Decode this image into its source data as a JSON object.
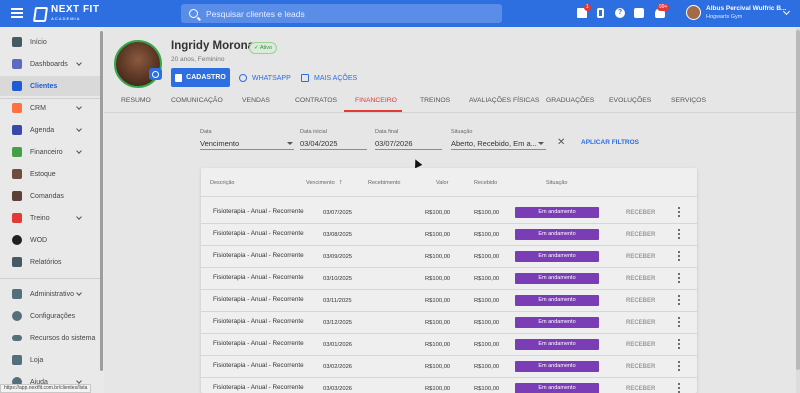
{
  "topbar": {
    "brand": "NEXT FIT",
    "brand_sub": "ACADEMIA",
    "search_placeholder": "Pesquisar clientes e leads",
    "gift_badge": "1",
    "notif_badge": "99+",
    "user_name": "Albus Percival Wulfric B...",
    "user_gym": "Hogwarts Gym",
    "help_glyph": "?"
  },
  "sidebar": {
    "items": [
      {
        "label": "Início",
        "icon": "home-icon",
        "color": "#455a64"
      },
      {
        "label": "Dashboards",
        "icon": "chart-icon",
        "color": "#5c6bc0"
      },
      {
        "label": "Clientes",
        "icon": "people-icon",
        "color": "#1e5bd4"
      },
      {
        "label": "CRM",
        "icon": "crm-icon",
        "color": "#ff7043"
      },
      {
        "label": "Agenda",
        "icon": "calendar-icon",
        "color": "#3949ab"
      },
      {
        "label": "Financeiro",
        "icon": "money-icon",
        "color": "#43a047"
      },
      {
        "label": "Estoque",
        "icon": "cart-icon",
        "color": "#6d4c41"
      },
      {
        "label": "Comandas",
        "icon": "receipt-icon",
        "color": "#5d4037"
      },
      {
        "label": "Treino",
        "icon": "dumbbell-icon",
        "color": "#e53935"
      },
      {
        "label": "WOD",
        "icon": "kettlebell-icon",
        "color": "#212121"
      },
      {
        "label": "Relatórios",
        "icon": "report-icon",
        "color": "#455a64"
      },
      {
        "label": "Administrativo",
        "icon": "admin-icon",
        "color": "#546e7a"
      },
      {
        "label": "Configurações",
        "icon": "gear-icon",
        "color": "#546e7a"
      },
      {
        "label": "Recursos do sistema",
        "icon": "toggle-icon",
        "color": "#546e7a"
      },
      {
        "label": "Loja",
        "icon": "store-icon",
        "color": "#546e7a"
      },
      {
        "label": "Ajuda",
        "icon": "help-icon",
        "color": "#546e7a"
      }
    ],
    "url_tooltip": "https://app.nextfit.com.br/clientes/lista"
  },
  "profile": {
    "name": "Ingridy Morona",
    "status": "Ativo",
    "info": "20 anos, Feminino",
    "cadastro_label": "CADASTRO",
    "whatsapp_label": "WHATSAPP",
    "mais_label": "MAIS AÇÕES"
  },
  "tabs": [
    "RESUMO",
    "COMUNICAÇÃO",
    "VENDAS",
    "CONTRATOS",
    "FINANCEIRO",
    "TREINOS",
    "AVALIAÇÕES FÍSICAS",
    "GRADUAÇÕES",
    "EVOLUÇÕES",
    "SERVIÇOS"
  ],
  "filters": {
    "data_label": "Data",
    "data_value": "Vencimento",
    "inicial_label": "Data inicial",
    "inicial_value": "03/04/2025",
    "final_label": "Data final",
    "final_value": "03/07/2026",
    "situacao_label": "Situação",
    "situacao_value": "Aberto, Recebido, Em a...",
    "clear_glyph": "✕",
    "apply_label": "APLICAR FILTROS"
  },
  "table": {
    "headers": {
      "descricao": "Descrição",
      "vencimento": "Vencimento",
      "recebimento": "Recebimento",
      "valor": "Valor",
      "recebido": "Recebido",
      "situacao": "Situação"
    },
    "sort_glyph": "↑",
    "action_label": "RECEBER",
    "rows": [
      {
        "desc": "Fisioterapia - Anual - Recorrente",
        "venc": "03/07/2025",
        "valor": "R$100,00",
        "recebido": "R$100,00",
        "status": "Em andamento"
      },
      {
        "desc": "Fisioterapia - Anual - Recorrente",
        "venc": "03/08/2025",
        "valor": "R$100,00",
        "recebido": "R$100,00",
        "status": "Em andamento"
      },
      {
        "desc": "Fisioterapia - Anual - Recorrente",
        "venc": "03/09/2025",
        "valor": "R$100,00",
        "recebido": "R$100,00",
        "status": "Em andamento"
      },
      {
        "desc": "Fisioterapia - Anual - Recorrente",
        "venc": "03/10/2025",
        "valor": "R$100,00",
        "recebido": "R$100,00",
        "status": "Em andamento"
      },
      {
        "desc": "Fisioterapia - Anual - Recorrente",
        "venc": "03/11/2025",
        "valor": "R$100,00",
        "recebido": "R$100,00",
        "status": "Em andamento"
      },
      {
        "desc": "Fisioterapia - Anual - Recorrente",
        "venc": "03/12/2025",
        "valor": "R$100,00",
        "recebido": "R$100,00",
        "status": "Em andamento"
      },
      {
        "desc": "Fisioterapia - Anual - Recorrente",
        "venc": "03/01/2026",
        "valor": "R$100,00",
        "recebido": "R$100,00",
        "status": "Em andamento"
      },
      {
        "desc": "Fisioterapia - Anual - Recorrente",
        "venc": "03/02/2026",
        "valor": "R$100,00",
        "recebido": "R$100,00",
        "status": "Em andamento"
      },
      {
        "desc": "Fisioterapia - Anual - Recorrente",
        "venc": "03/03/2026",
        "valor": "R$100,00",
        "recebido": "R$100,00",
        "status": "Em andamento"
      }
    ]
  }
}
